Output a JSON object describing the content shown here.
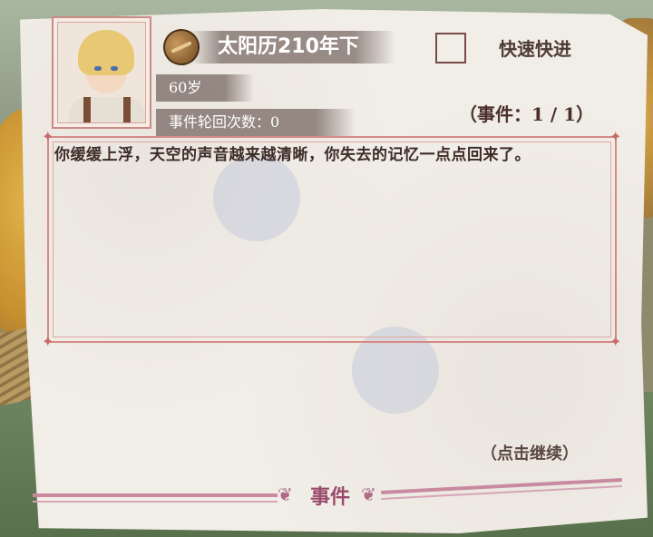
{
  "header": {
    "date": "太阳历210年下",
    "age": "60岁",
    "cycle_count": "事件轮回次数：0"
  },
  "fast_forward": {
    "label": "快速快进"
  },
  "event_counter": "（事件：1 / 1）",
  "event_text": "你缓缓上浮，天空的声音越来越清晰，你失去的记忆一点点回来了。",
  "continue_label": "（点击继续）",
  "footer": {
    "title": "事件"
  },
  "icons": {
    "coin": "coin-icon",
    "portrait": "character-portrait"
  }
}
